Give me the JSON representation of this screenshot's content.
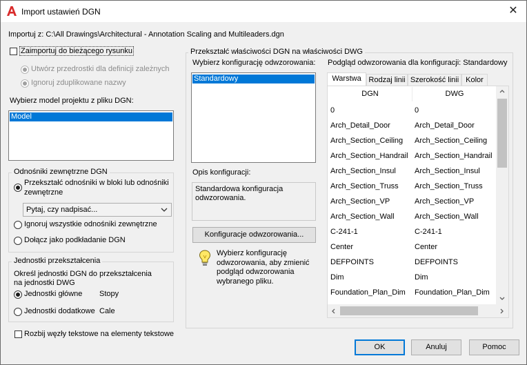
{
  "window": {
    "title": "Import ustawień DGN",
    "close_glyph": "✕"
  },
  "import_from": {
    "label": "Importuj z:",
    "path": "C:\\All Drawings\\Architectural - Annotation Scaling and Multileaders.dgn"
  },
  "left": {
    "import_into_current": "Zaimportuj do bieżącego rysunku",
    "create_previews": "Utwórz przedrostki dla definicji zależnych",
    "ignore_duplicates": "Ignoruj zduplikowane nazwy",
    "model_label": "Wybierz model projektu z pliku DGN:",
    "models": [
      "Model"
    ],
    "xrefs": {
      "title": "Odnośniki zewnętrzne DGN",
      "convert_line1": "Przekształć odnośniki w bloki lub odnośniki",
      "convert_line2": "zewnętrzne",
      "combo_value": "Pytaj, czy nadpisać...",
      "ignore_all": "Ignoruj wszystkie odnośniki zewnętrzne",
      "attach_underlay": "Dołącz jako podkładanie DGN"
    },
    "units": {
      "title": "Jednostki przekształcenia",
      "desc_line1": "Określ jednostki DGN do przekształcenia",
      "desc_line2": "na jednostki DWG",
      "master_label": "Jednostki główne",
      "master_value": "Stopy",
      "sub_label": "Jednostki dodatkowe",
      "sub_value": "Cale"
    },
    "explode_text": "Rozbij węzły tekstowe na elementy tekstowe"
  },
  "mapping": {
    "group_title": "Przekształć właściwości DGN na właściwości DWG",
    "select_label": "Wybierz konfigurację odwzorowania:",
    "configs": [
      "Standardowy"
    ],
    "desc_label": "Opis konfiguracji:",
    "desc_text_line1": "Standardowa konfiguracja",
    "desc_text_line2": "odwzorowania.",
    "configs_button": "Konfiguracje odwzorowania...",
    "hint_lines": [
      "Wybierz konfigurację",
      "odwzorowania, aby zmienić",
      "podgląd odwzorowania",
      "wybranego pliku."
    ]
  },
  "preview": {
    "title": "Podgląd odwzorowania dla konfiguracji: Standardowy",
    "tabs": [
      "Warstwa",
      "Rodzaj linii",
      "Szerokość linii",
      "Kolor"
    ],
    "columns": [
      "DGN",
      "DWG"
    ],
    "rows": [
      [
        "0",
        "0"
      ],
      [
        "Arch_Detail_Door",
        "Arch_Detail_Door"
      ],
      [
        "Arch_Section_Ceiling",
        "Arch_Section_Ceiling"
      ],
      [
        "Arch_Section_Handrail",
        "Arch_Section_Handrail"
      ],
      [
        "Arch_Section_Insul",
        "Arch_Section_Insul"
      ],
      [
        "Arch_Section_Truss",
        "Arch_Section_Truss"
      ],
      [
        "Arch_Section_VP",
        "Arch_Section_VP"
      ],
      [
        "Arch_Section_Wall",
        "Arch_Section_Wall"
      ],
      [
        "C-241-1",
        "C-241-1"
      ],
      [
        "Center",
        "Center"
      ],
      [
        "DEFPOINTS",
        "DEFPOINTS"
      ],
      [
        "Dim",
        "Dim"
      ],
      [
        "Foundation_Plan_Dim",
        "Foundation_Plan_Dim"
      ]
    ]
  },
  "buttons": {
    "ok": "OK",
    "cancel": "Anuluj",
    "help": "Pomoc"
  },
  "colors": {
    "brand_red": "#d92b2b",
    "selection_blue": "#0078d7"
  }
}
